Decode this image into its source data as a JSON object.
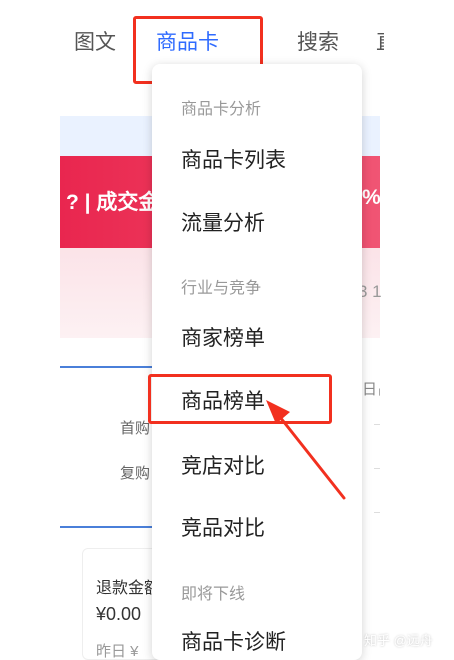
{
  "tabs": {
    "tuwen": "图文",
    "goods_card": "商品卡",
    "search": "搜索",
    "more": "直"
  },
  "background": {
    "banner_text": "? | 成交金",
    "banner_right": "%",
    "pink_right": "3 1",
    "first_label": "首购",
    "repeat_label": "复购",
    "right_top": "日占",
    "card_title": "退款金额",
    "card_value": "¥0.00",
    "card_yesterday": "昨日 ¥"
  },
  "dropdown": {
    "group_analysis": "商品卡分析",
    "item_list": "商品卡列表",
    "item_traffic": "流量分析",
    "group_industry": "行业与竞争",
    "item_merchant_rank": "商家榜单",
    "item_goods_rank": "商品榜单",
    "item_shop_compare": "竞店对比",
    "item_goods_compare": "竞品对比",
    "group_offline": "即将下线",
    "item_diagnosis": "商品卡诊断"
  },
  "watermark": "知乎 @远舟",
  "colors": {
    "accent_blue": "#2f6bff",
    "annotation_red": "#f2301f",
    "banner_red": "#e9264f"
  }
}
